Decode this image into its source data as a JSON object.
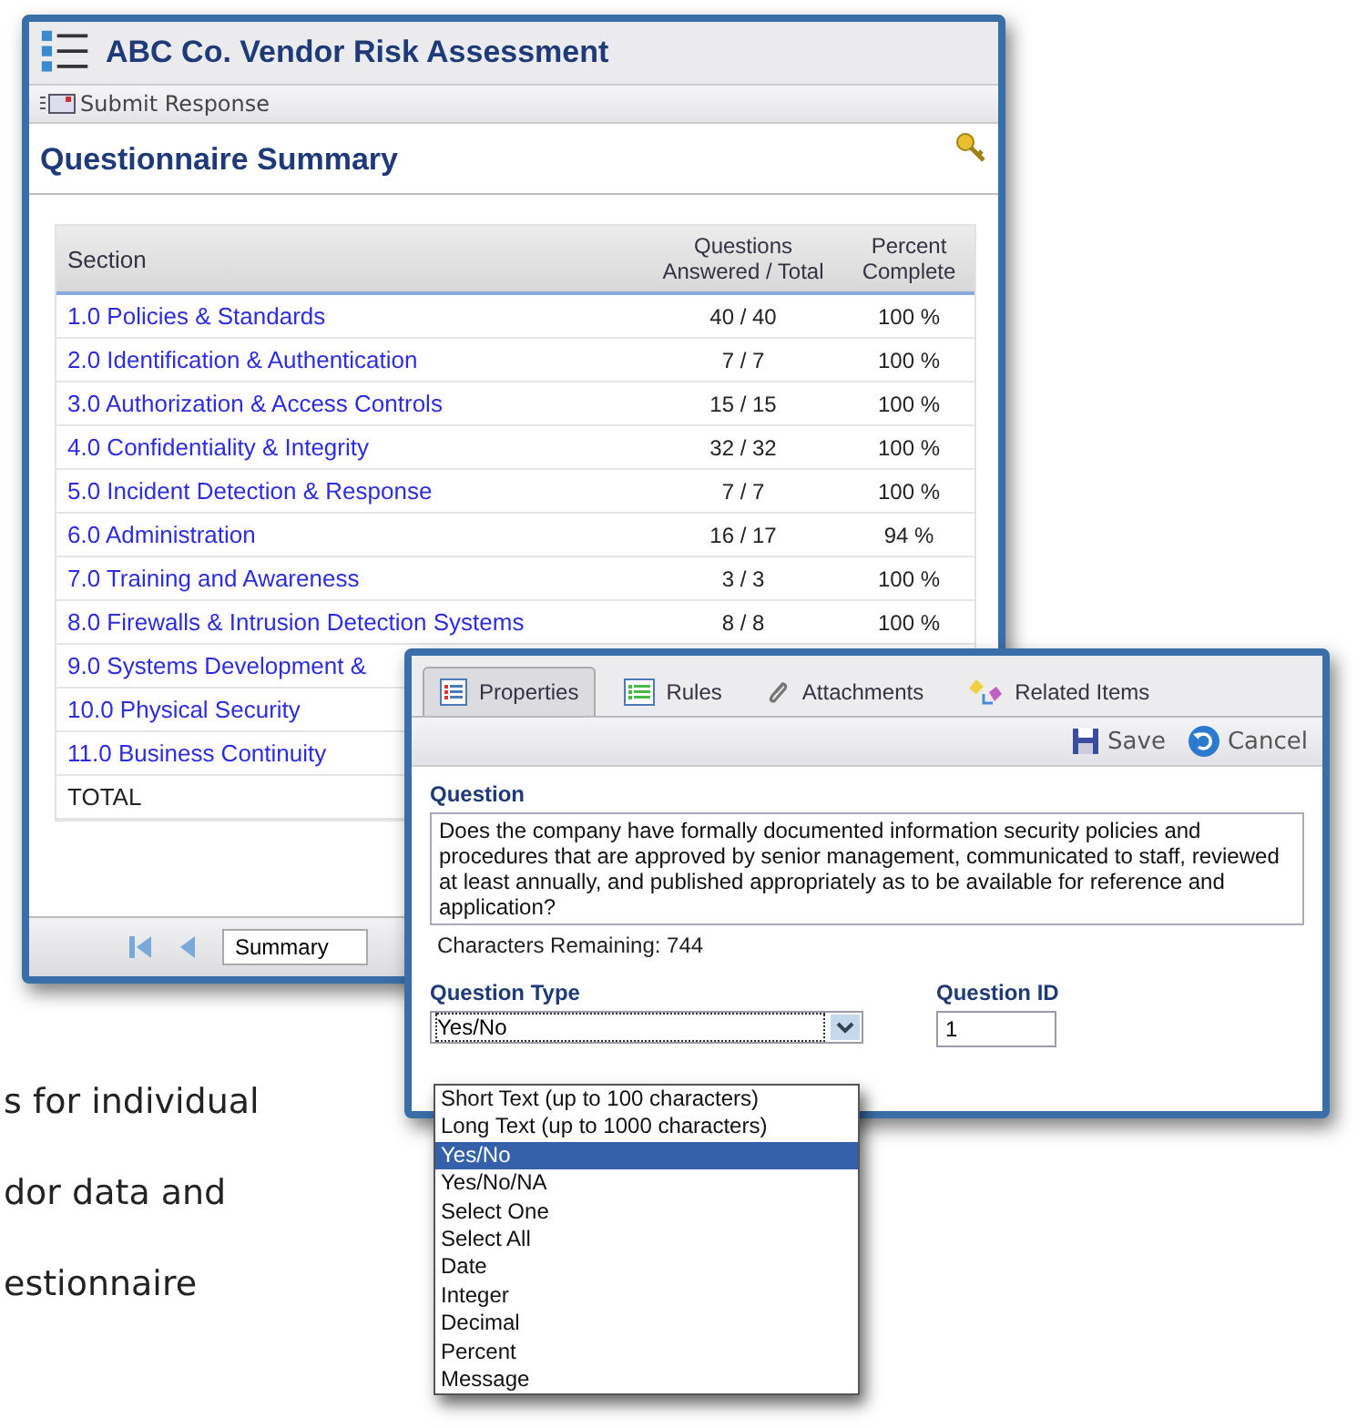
{
  "slide_text": [
    "s for individual",
    "dor data and",
    "estionnaire"
  ],
  "summary_window": {
    "title": "ABC Co. Vendor Risk Assessment",
    "toolbar": {
      "submit": "Submit Response"
    },
    "heading": "Questionnaire Summary",
    "table": {
      "columns": [
        "Section",
        "Questions Answered / Total",
        "Percent Complete"
      ],
      "rows": [
        {
          "section": "1.0 Policies & Standards",
          "answered": "40 / 40",
          "percent": "100 %"
        },
        {
          "section": "2.0 Identification & Authentication",
          "answered": "7 / 7",
          "percent": "100 %"
        },
        {
          "section": "3.0 Authorization & Access Controls",
          "answered": "15 / 15",
          "percent": "100 %"
        },
        {
          "section": "4.0 Confidentiality & Integrity",
          "answered": "32 / 32",
          "percent": "100 %"
        },
        {
          "section": "5.0 Incident Detection & Response",
          "answered": "7 / 7",
          "percent": "100 %"
        },
        {
          "section": "6.0 Administration",
          "answered": "16 / 17",
          "percent": "94 %"
        },
        {
          "section": "7.0 Training and Awareness",
          "answered": "3 / 3",
          "percent": "100 %"
        },
        {
          "section": "8.0 Firewalls & Intrusion Detection Systems",
          "answered": "8 / 8",
          "percent": "100 %"
        },
        {
          "section": "9.0 Systems Development &"
        },
        {
          "section": "10.0 Physical Security"
        },
        {
          "section": "11.0 Business Continuity"
        },
        {
          "section": "TOTAL",
          "kind": "total"
        }
      ]
    },
    "pager": {
      "page": "Summary"
    }
  },
  "question_window": {
    "tabs": [
      {
        "label": "Properties",
        "selected": true,
        "kind": "list"
      },
      {
        "label": "Rules",
        "selected": false,
        "kind": "rules"
      },
      {
        "label": "Attachments",
        "selected": false,
        "kind": "clip"
      },
      {
        "label": "Related Items",
        "selected": false,
        "kind": "related"
      }
    ],
    "toolbar": {
      "save": "Save",
      "cancel": "Cancel"
    },
    "question_label": "Question",
    "question_text": "Does the company have formally documented information security policies and procedures that are approved by senior management, communicated to staff, reviewed at least annually, and published appropriately as to be available for reference and application?",
    "characters_remaining": "Characters Remaining: 744",
    "question_type_label": "Question Type",
    "question_type_value": "Yes/No",
    "question_id_label": "Question ID",
    "question_id_value": "1",
    "type_options": [
      {
        "label": "Short Text (up to 100 characters)",
        "selected": false
      },
      {
        "label": "Long Text (up to 1000 characters)",
        "selected": false
      },
      {
        "label": "Yes/No",
        "selected": true
      },
      {
        "label": "Yes/No/NA",
        "selected": false
      },
      {
        "label": "Select One",
        "selected": false
      },
      {
        "label": "Select All",
        "selected": false
      },
      {
        "label": "Date",
        "selected": false
      },
      {
        "label": "Integer",
        "selected": false
      },
      {
        "label": "Decimal",
        "selected": false
      },
      {
        "label": "Percent",
        "selected": false
      },
      {
        "label": "Message",
        "selected": false
      }
    ]
  }
}
